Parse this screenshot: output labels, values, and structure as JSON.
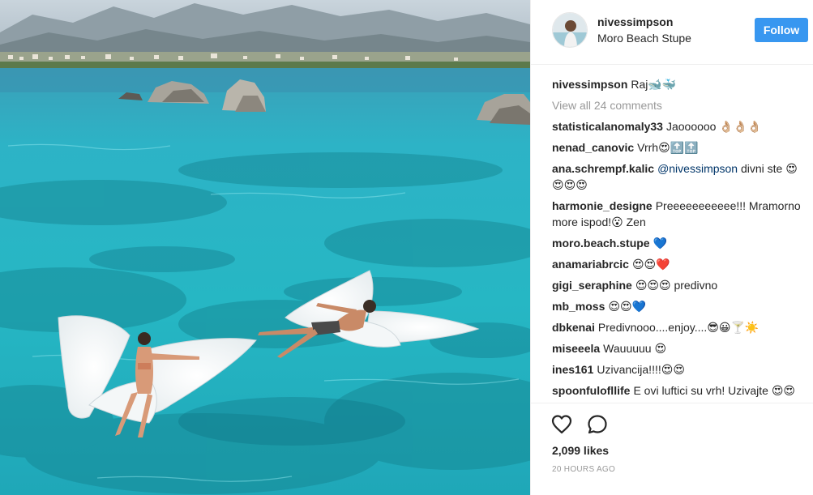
{
  "post": {
    "username": "nivessimpson",
    "location": "Moro Beach Stupe",
    "follow_label": "Follow",
    "caption_user": "nivessimpson",
    "caption_text": "Raj🐋🐳",
    "view_all_comments": "View all 24 comments"
  },
  "comments": [
    {
      "user": "statisticalanomaly33",
      "text": "Jaoooooo 👌🏼👌🏼👌🏼"
    },
    {
      "user": "nenad_canovic",
      "text": "Vrrh😍🔝🔝"
    },
    {
      "user": "ana.schrempf.kalic",
      "mention": "@nivessimpson",
      "text": " divni ste 😍😍😍😍"
    },
    {
      "user": "harmonie_designe",
      "text": "Preeeeeeeeeee!!! Mramorno more ispod!😮 Zen"
    },
    {
      "user": "moro.beach.stupe",
      "text": "💙"
    },
    {
      "user": "anamariabrcic",
      "text": "😍😍❤️"
    },
    {
      "user": "gigi_seraphine",
      "text": "😍😍😍 predivno"
    },
    {
      "user": "mb_moss",
      "text": "😍😍💙"
    },
    {
      "user": "dbkenai",
      "text": "Predivnooo....enjoy....😎😀🍸☀️"
    },
    {
      "user": "miseeela",
      "text": "Wauuuuu 😍"
    },
    {
      "user": "ines161",
      "text": "Uzivancija!!!!😍😍"
    },
    {
      "user": "spoonfulofllife",
      "text": "E ovi luftici su vrh! Uzivajte 😍😍"
    }
  ],
  "engagement": {
    "likes": "2,099 likes",
    "timestamp": "20 HOURS AGO"
  },
  "colors": {
    "follow_button": "#3897f0",
    "mention": "#003569",
    "secondary_text": "#999999",
    "water": "#2fb6c4"
  },
  "icons": {
    "like": "heart-outline-icon",
    "comment": "speech-bubble-icon"
  }
}
